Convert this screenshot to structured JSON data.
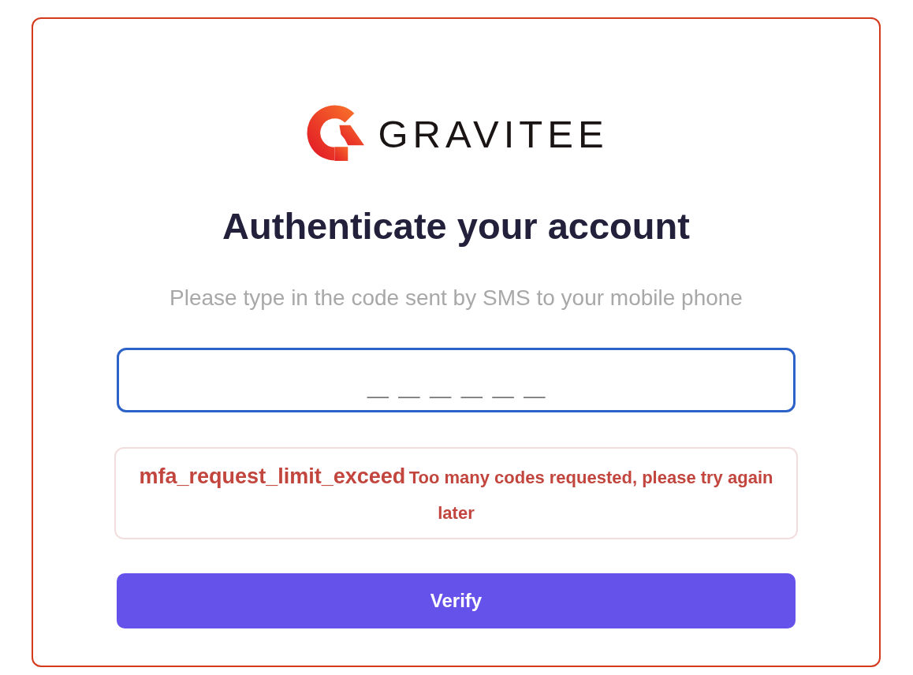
{
  "logo": {
    "text": "GRAVITEE"
  },
  "heading": "Authenticate your account",
  "subtitle": "Please type in the code sent by SMS to your mobile phone",
  "code_input": {
    "placeholder": "______",
    "focused": true
  },
  "error": {
    "code": "mfa_request_limit_exceed",
    "message": "Too many codes requested, please try again later"
  },
  "verify_button": {
    "label": "Verify"
  }
}
